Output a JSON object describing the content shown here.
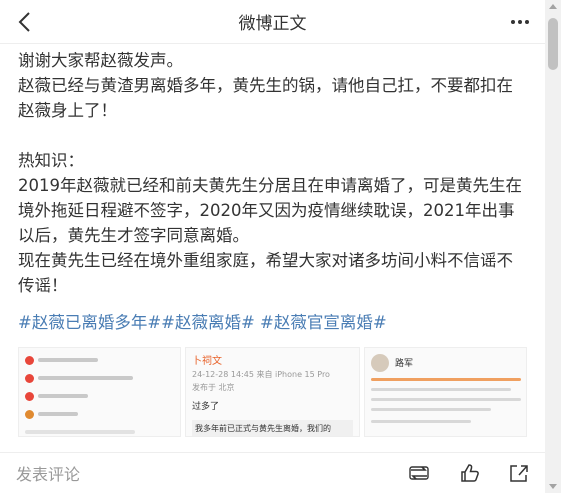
{
  "header": {
    "title": "微博正文",
    "back_icon": "chevron-left-icon",
    "more_icon": "more-horizontal-icon"
  },
  "post": {
    "paragraphs": [
      "谢谢大家帮赵薇发声。",
      "赵薇已经与黄渣男离婚多年，黄先生的锅，请他自己扛，不要都扣在赵薇身上了！",
      "",
      "热知识：",
      "2019年赵薇就已经和前夫黄先生分居且在申请离婚了，可是黄先生在境外拖延日程避不签字，2020年又因为疫情继续耽误，2021年出事以后，黄先生才签字同意离婚。",
      "现在黄先生已经在境外重组家庭，希望大家对诸多坊间小料不信谣不传谣！"
    ],
    "hashtags": [
      "#赵薇已离婚多年#",
      "#赵薇离婚#",
      " #赵薇官宣离婚#"
    ],
    "images": {
      "image2": {
        "name": "卜祠文",
        "meta_line1": "24-12-28 14:45 来自 iPhone 15 Pro",
        "meta_line2": "发布于 北京",
        "text": "过多了",
        "quote": "我多年前已正式与黄先生离婚，我们的"
      },
      "image3": {
        "name": "路军"
      }
    }
  },
  "bottom_bar": {
    "comment_placeholder": "发表评论",
    "repost_icon": "repost-icon",
    "like_icon": "thumbs-up-icon",
    "share_icon": "share-icon"
  },
  "colors": {
    "hashtag": "#4a7db4",
    "text": "#333333",
    "placeholder": "#999999"
  }
}
